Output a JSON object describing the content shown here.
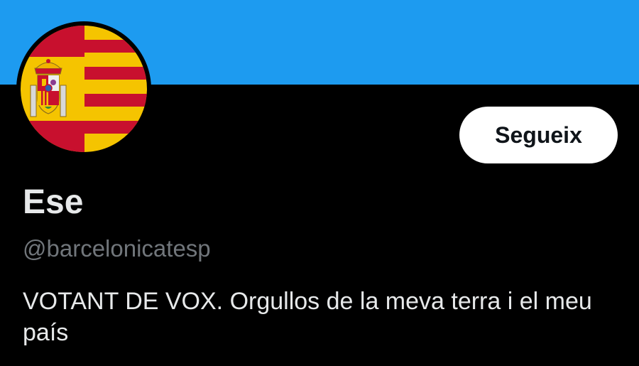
{
  "colors": {
    "banner": "#1d9bf0",
    "background": "#000000",
    "primary_text": "#e7e9ea",
    "secondary_text": "#71767b",
    "button_bg": "#ffffff",
    "button_text": "#0f1419",
    "flag_red": "#c8102e",
    "flag_yellow": "#f5c400"
  },
  "profile": {
    "avatar_icon": "spain-catalonia-flag-avatar",
    "follow_label": "Segueix",
    "display_name": "Ese",
    "handle": "@barcelonicatesp",
    "bio": "VOTANT DE VOX. Orgullos de la meva terra i el meu país"
  }
}
